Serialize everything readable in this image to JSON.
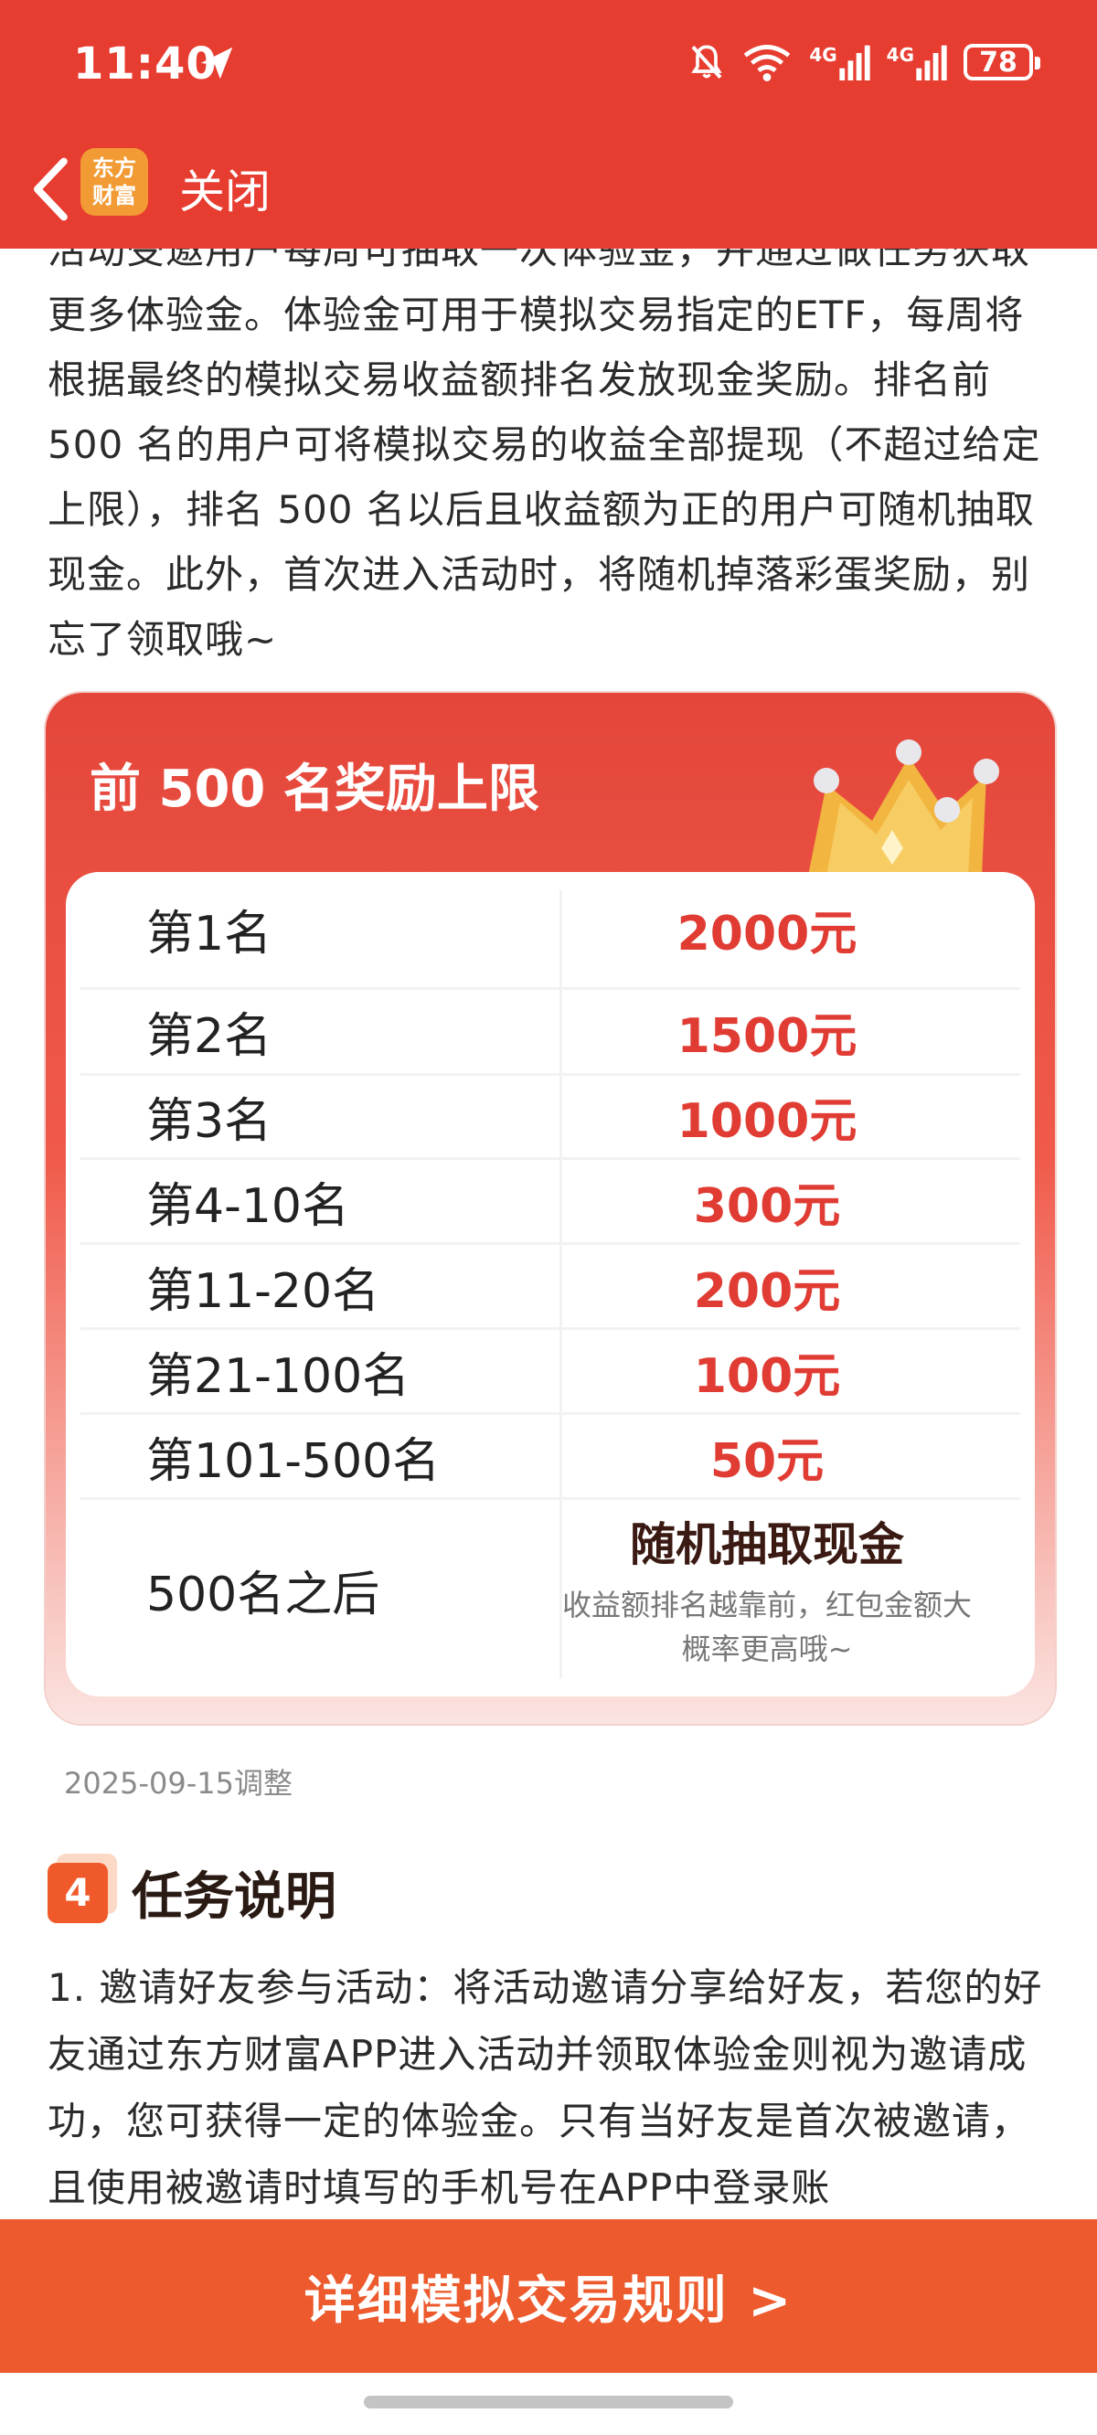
{
  "status_bar": {
    "time": "11:40",
    "network_1": "4G",
    "network_2": "4G",
    "battery": "78"
  },
  "nav": {
    "logo_line1": "东方",
    "logo_line2": "财富",
    "close_label": "关闭"
  },
  "intro_text": "活动受邀用户每周可抽取一次体验金，并通过做任务获取更多体验金。体验金可用于模拟交易指定的ETF，每周将根据最终的模拟交易收益额排名发放现金奖励。排名前 500 名的用户可将模拟交易的收益全部提现（不超过给定上限），排名 500 名以后且收益额为正的用户可随机抽取现金。此外，首次进入活动时，将随机掉落彩蛋奖励，别忘了领取哦~",
  "reward_card": {
    "title": "前 500 名奖励上限",
    "rows": [
      {
        "rank": "第1名",
        "amount": "2000元"
      },
      {
        "rank": "第2名",
        "amount": "1500元"
      },
      {
        "rank": "第3名",
        "amount": "1000元"
      },
      {
        "rank": "第4-10名",
        "amount": "300元"
      },
      {
        "rank": "第11-20名",
        "amount": "200元"
      },
      {
        "rank": "第21-100名",
        "amount": "100元"
      },
      {
        "rank": "第101-500名",
        "amount": "50元"
      }
    ],
    "last_row": {
      "rank": "500名之后",
      "amount": "随机抽取现金",
      "note_line1": "收益额排名越靠前，红包金额大",
      "note_line2": "概率更高哦~"
    }
  },
  "adjust_date": "2025-09-15调整",
  "task_section": {
    "number": "4",
    "title": "任务说明",
    "text": "1. 邀请好友参与活动：将活动邀请分享给好友，若您的好友通过东方财富APP进入活动并领取体验金则视为邀请成功，您可获得一定的体验金。只有当好友是首次被邀请，且使用被邀请时填写的手机号在APP中登录账"
  },
  "bottom_button": {
    "label": "详细模拟交易规则 >"
  },
  "colors": {
    "header_red": "#e73c30",
    "amount_red": "#e03c33",
    "button_orange": "#ec5a2d"
  },
  "icons": [
    "send-icon",
    "bell-off-icon",
    "wifi-icon",
    "signal-icon",
    "battery-icon",
    "back-icon",
    "crown-icon"
  ]
}
